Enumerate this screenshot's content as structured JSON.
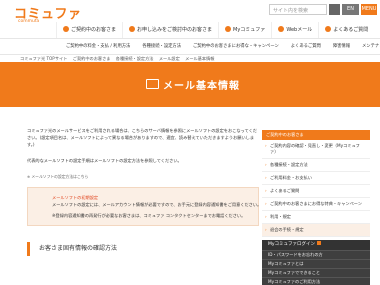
{
  "header": {
    "logo": "コミュファ",
    "logo_sub": "commufa",
    "search_placeholder": "サイト内を検索",
    "btn_en": "EN",
    "btn_menu": "MENU"
  },
  "nav": [
    {
      "label": "ご契約中のお客さま"
    },
    {
      "label": "お申し込みをご検討中のお客さま"
    },
    {
      "label": "Myコミュファ"
    },
    {
      "label": "Webメール"
    },
    {
      "label": "よくあるご質問"
    }
  ],
  "subnav": [
    "ご契約中の料金・支払 / 利用方法",
    "各種接続・設定方法",
    "ご契約中のお客さまにお得な・キャンペーン",
    "よくあるご質問",
    "障害情報",
    "メンテナンス情報"
  ],
  "breadcrumb": [
    "コミュファ光 TOPサイト",
    "ご契約中のお客さま",
    "各種接続・設定方法",
    "メール設定",
    "メール基本情報"
  ],
  "hero": {
    "title": "メール基本情報"
  },
  "main": {
    "p1": "コミュファ光のメールサービスをご利用される場合は、こちらのサーバ情報を参照にメールソフトの設定をおこなってください。(設定項目名は、メールソフトによって異なる場合がありますので、適宜、読み替えていただきますようお願いします。)",
    "p2": "代表的なメールソフトの設定手順はメールソフトの設定方法を参照してください。",
    "p3": "※ メールソフトの設定方法はこちら",
    "note_title": "メールソフトの初期設定",
    "note_1": "メールソフトの設定には、メールアカウント情報が必要ですので、お手元に登録内容通知書をご用意ください。",
    "note_2": "※登録内容通知書の再発行が必要なお客さまは、コミュファ コンタクトセンターまでお電話ください。",
    "section_title": "お客さま固有情報の確認方法"
  },
  "sidebar": {
    "head": "ご契約中のお客さま",
    "items": [
      "ご契約内容の確認・見直し・変更（Myコミュファ）",
      "各種接続・設定方法",
      "ご利用料金・お支払い",
      "よくあるご質問",
      "ご契約中のお客さまにお得な特典・キャンペーン",
      "利用・規定"
    ],
    "active_item": "退会の手続・規定",
    "login_label": "Myコミュファログイン",
    "dark_items": [
      "ID・パスワードをお忘れの方",
      "Myコミュファとは",
      "Myコミュファでできること",
      "Myコミュファのご利用方法"
    ]
  }
}
